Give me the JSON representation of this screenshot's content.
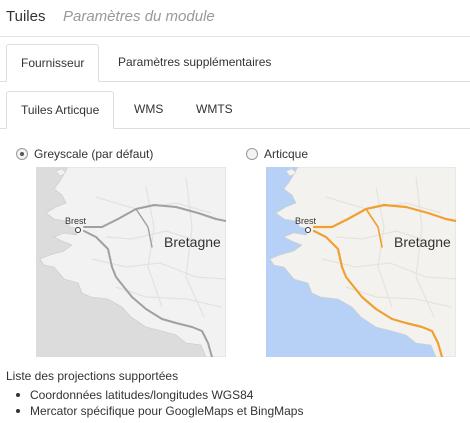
{
  "header": {
    "title": "Tuiles",
    "subtitle": "Paramètres du module"
  },
  "tabs_main": [
    {
      "label": "Fournisseur",
      "active": true
    },
    {
      "label": "Paramètres supplémentaires",
      "active": false
    }
  ],
  "tabs_sub": [
    {
      "label": "Tuiles Articque",
      "active": true
    },
    {
      "label": "WMS",
      "active": false
    },
    {
      "label": "WMTS",
      "active": false
    }
  ],
  "options": [
    {
      "label": "Greyscale (par défaut)",
      "selected": true
    },
    {
      "label": "Articque",
      "selected": false
    }
  ],
  "maps": [
    {
      "city": "Brest",
      "region": "Bretagne",
      "sea_color": "#dcdcdc",
      "land_color": "#f2f2f2",
      "road_color": "#a0a0a0"
    },
    {
      "city": "Brest",
      "region": "Bretagne",
      "sea_color": "#b7d0f5",
      "land_color": "#f3f2ee",
      "road_color": "#f0a030"
    }
  ],
  "projections": {
    "title": "Liste des projections supportées",
    "items": [
      "Coordonnées latitudes/longitudes WGS84",
      "Mercator spécifique pour GoogleMaps et BingMaps"
    ]
  }
}
